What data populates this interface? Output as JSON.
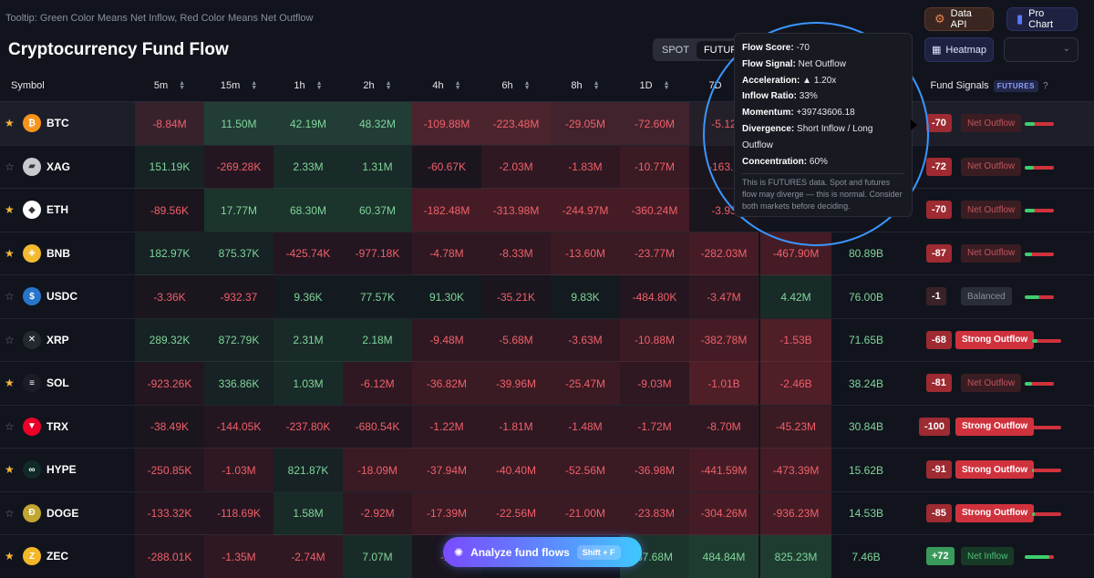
{
  "hint": "Tooltip: Green Color Means Net Inflow, Red Color Means Net Outflow",
  "title": "Cryptocurrency Fund Flow",
  "top_buttons": {
    "data_api": "Data API",
    "pro_chart": "Pro Chart",
    "heatmap": "Heatmap"
  },
  "market_toggle": {
    "spot": "SPOT",
    "futures": "FUTUR"
  },
  "headers": {
    "symbol": "Symbol",
    "c5m": "5m",
    "c15m": "15m",
    "c1h": "1h",
    "c2h": "2h",
    "c4h": "4h",
    "c6h": "6h",
    "c8h": "8h",
    "c1d": "1D",
    "c7d": "7D",
    "fund_signals": "Fund Signals",
    "futures_badge": "FUTURES",
    "help": "?"
  },
  "rows": [
    {
      "symbol": "BTC",
      "icon": "bitcoin-icon",
      "starred": true,
      "highlighted": true,
      "cells": [
        "-8.84M",
        "11.50M",
        "42.19M",
        "48.32M",
        "-109.88M",
        "-223.48M",
        "-29.05M",
        "-72.60M",
        "-5.12"
      ],
      "extra": [
        "",
        ""
      ],
      "score": "-70",
      "signal": "Net Outflow",
      "sig_type": "net-out",
      "inflow_ratio": 0.33
    },
    {
      "symbol": "XAG",
      "icon": "silver-bar-icon",
      "starred": false,
      "cells": [
        "151.19K",
        "-269.28K",
        "2.33M",
        "1.31M",
        "-60.67K",
        "-2.03M",
        "-1.83M",
        "-10.77M",
        "-163.3"
      ],
      "extra": [
        "",
        ""
      ],
      "score": "-72",
      "signal": "Net Outflow",
      "sig_type": "net-out",
      "inflow_ratio": 0.3
    },
    {
      "symbol": "ETH",
      "icon": "ethereum-icon",
      "starred": true,
      "cells": [
        "-89.56K",
        "17.77M",
        "68.30M",
        "60.37M",
        "-182.48M",
        "-313.98M",
        "-244.97M",
        "-360.24M",
        "-3.93"
      ],
      "extra": [
        "",
        ""
      ],
      "score": "-70",
      "signal": "Net Outflow",
      "sig_type": "net-out",
      "inflow_ratio": 0.33
    },
    {
      "symbol": "BNB",
      "icon": "bnb-icon",
      "starred": true,
      "cells": [
        "182.97K",
        "875.37K",
        "-425.74K",
        "-977.18K",
        "-4.78M",
        "-8.33M",
        "-13.60M",
        "-23.77M",
        "-282.03M"
      ],
      "extra": [
        "-467.90M",
        "80.89B"
      ],
      "score": "-87",
      "signal": "Net Outflow",
      "sig_type": "net-out",
      "inflow_ratio": 0.25
    },
    {
      "symbol": "USDC",
      "icon": "usdc-icon",
      "starred": false,
      "cells": [
        "-3.36K",
        "-932.37",
        "9.36K",
        "77.57K",
        "91.30K",
        "-35.21K",
        "9.83K",
        "-484.80K",
        "-3.47M"
      ],
      "extra": [
        "4.42M",
        "76.00B"
      ],
      "score": "-1",
      "signal": "Balanced",
      "sig_type": "balanced",
      "inflow_ratio": 0.5
    },
    {
      "symbol": "XRP",
      "icon": "xrp-icon",
      "starred": false,
      "cells": [
        "289.32K",
        "872.79K",
        "2.31M",
        "2.18M",
        "-9.48M",
        "-5.68M",
        "-3.63M",
        "-10.88M",
        "-382.78M"
      ],
      "extra": [
        "-1.53B",
        "71.65B"
      ],
      "score": "-68",
      "signal": "Strong Outflow",
      "sig_type": "strong-out",
      "inflow_ratio": 0.2
    },
    {
      "symbol": "SOL",
      "icon": "solana-icon",
      "starred": true,
      "cells": [
        "-923.26K",
        "336.86K",
        "1.03M",
        "-6.12M",
        "-36.82M",
        "-39.96M",
        "-25.47M",
        "-9.03M",
        "-1.01B"
      ],
      "extra": [
        "-2.46B",
        "38.24B"
      ],
      "score": "-81",
      "signal": "Net Outflow",
      "sig_type": "net-out",
      "inflow_ratio": 0.25
    },
    {
      "symbol": "TRX",
      "icon": "tron-icon",
      "starred": false,
      "cells": [
        "-38.49K",
        "-144.05K",
        "-237.80K",
        "-680.54K",
        "-1.22M",
        "-1.81M",
        "-1.48M",
        "-1.72M",
        "-8.70M"
      ],
      "extra": [
        "-45.23M",
        "30.84B"
      ],
      "score": "-100",
      "signal": "Strong Outflow",
      "sig_type": "strong-out",
      "inflow_ratio": 0.0
    },
    {
      "symbol": "HYPE",
      "icon": "hyperliquid-icon",
      "starred": true,
      "cells": [
        "-250.85K",
        "-1.03M",
        "821.87K",
        "-18.09M",
        "-37.94M",
        "-40.40M",
        "-52.56M",
        "-36.98M",
        "-441.59M"
      ],
      "extra": [
        "-473.39M",
        "15.62B"
      ],
      "score": "-91",
      "signal": "Strong Outflow",
      "sig_type": "strong-out",
      "inflow_ratio": 0.06
    },
    {
      "symbol": "DOGE",
      "icon": "dogecoin-icon",
      "starred": false,
      "cells": [
        "-133.32K",
        "-118.69K",
        "1.58M",
        "-2.92M",
        "-17.39M",
        "-22.56M",
        "-21.00M",
        "-23.83M",
        "-304.26M"
      ],
      "extra": [
        "-936.23M",
        "14.53B"
      ],
      "score": "-85",
      "signal": "Strong Outflow",
      "sig_type": "strong-out",
      "inflow_ratio": 0.08
    },
    {
      "symbol": "ZEC",
      "icon": "zcash-icon",
      "starred": true,
      "cells": [
        "-288.01K",
        "-1.35M",
        "-2.74M",
        "7.07M",
        "-2.",
        "",
        "",
        "87.68M",
        "484.84M"
      ],
      "extra": [
        "825.23M",
        "7.46B"
      ],
      "score": "+72",
      "signal": "Net Inflow",
      "sig_type": "net-in",
      "inflow_ratio": 0.85
    }
  ],
  "tooltip": {
    "flow_score_label": "Flow Score:",
    "flow_score": "-70",
    "flow_signal_label": "Flow Signal:",
    "flow_signal": "Net Outflow",
    "acceleration_label": "Acceleration:",
    "acceleration": "▲ 1.20x",
    "inflow_ratio_label": "Inflow Ratio:",
    "inflow_ratio": "33%",
    "momentum_label": "Momentum:",
    "momentum": "+39743606.18",
    "divergence_label": "Divergence:",
    "divergence": "Short Inflow / Long Outflow",
    "concentration_label": "Concentration:",
    "concentration": "60%",
    "note": "This is FUTURES data. Spot and futures flow may diverge — this is normal. Consider both markets before deciding."
  },
  "analyze": {
    "label": "Analyze fund flows",
    "shortcut": "Shift + F"
  },
  "colors": {
    "positive": "#7fd69b",
    "negative": "#f0606a",
    "accent": "#5b79ff"
  }
}
